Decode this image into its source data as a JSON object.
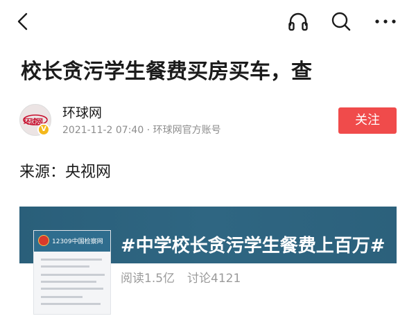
{
  "topbar": {
    "icons": [
      "back-icon",
      "headphone-icon",
      "search-icon",
      "more-icon"
    ]
  },
  "article": {
    "title": "校长贪污学生餐费买房买车，查",
    "author": {
      "name": "环球网",
      "meta": "2021-11-2 07:40 · 环球网官方账号",
      "avatar_text": "环球网",
      "verified_mark": "V"
    },
    "follow_label": "关注",
    "source_line": "来源：央视网"
  },
  "topic_card": {
    "title": "#中学校长贪污学生餐费上百万#",
    "reads": "阅读1.5亿",
    "comments": "讨论4121",
    "thumb_header": "12309中国检察网"
  },
  "colors": {
    "accent_red": "#f04b4b",
    "banner_blue": "#2f6682",
    "text_primary": "#1b1b1b",
    "text_secondary": "#8c8c8c"
  }
}
